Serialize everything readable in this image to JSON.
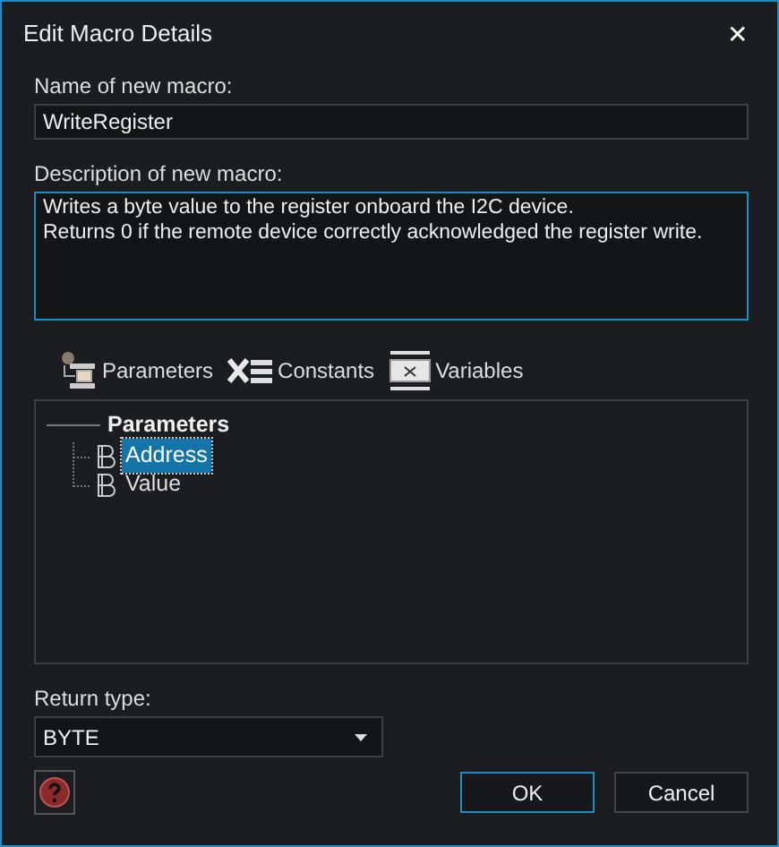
{
  "window": {
    "title": "Edit Macro Details",
    "close": "✕"
  },
  "name_field": {
    "label": "Name of new macro:",
    "value": "WriteRegister"
  },
  "description_field": {
    "label": "Description of new macro:",
    "value": "Writes a byte value to the register onboard the I2C device.\nReturns 0 if the remote device correctly acknowledged the register write."
  },
  "tabs": [
    {
      "label": "Parameters",
      "kind": "parameters"
    },
    {
      "label": "Constants",
      "kind": "constants"
    },
    {
      "label": "Variables",
      "kind": "variables"
    }
  ],
  "tree": [
    {
      "label": "Parameters",
      "children": [
        {
          "label": "Address",
          "selected": true
        },
        {
          "label": "Value",
          "selected": false
        }
      ]
    }
  ],
  "return_type": {
    "label": "Return type:",
    "value": "BYTE"
  },
  "buttons": [
    {
      "label": "OK",
      "default": true
    },
    {
      "label": "Cancel",
      "default": false
    }
  ]
}
